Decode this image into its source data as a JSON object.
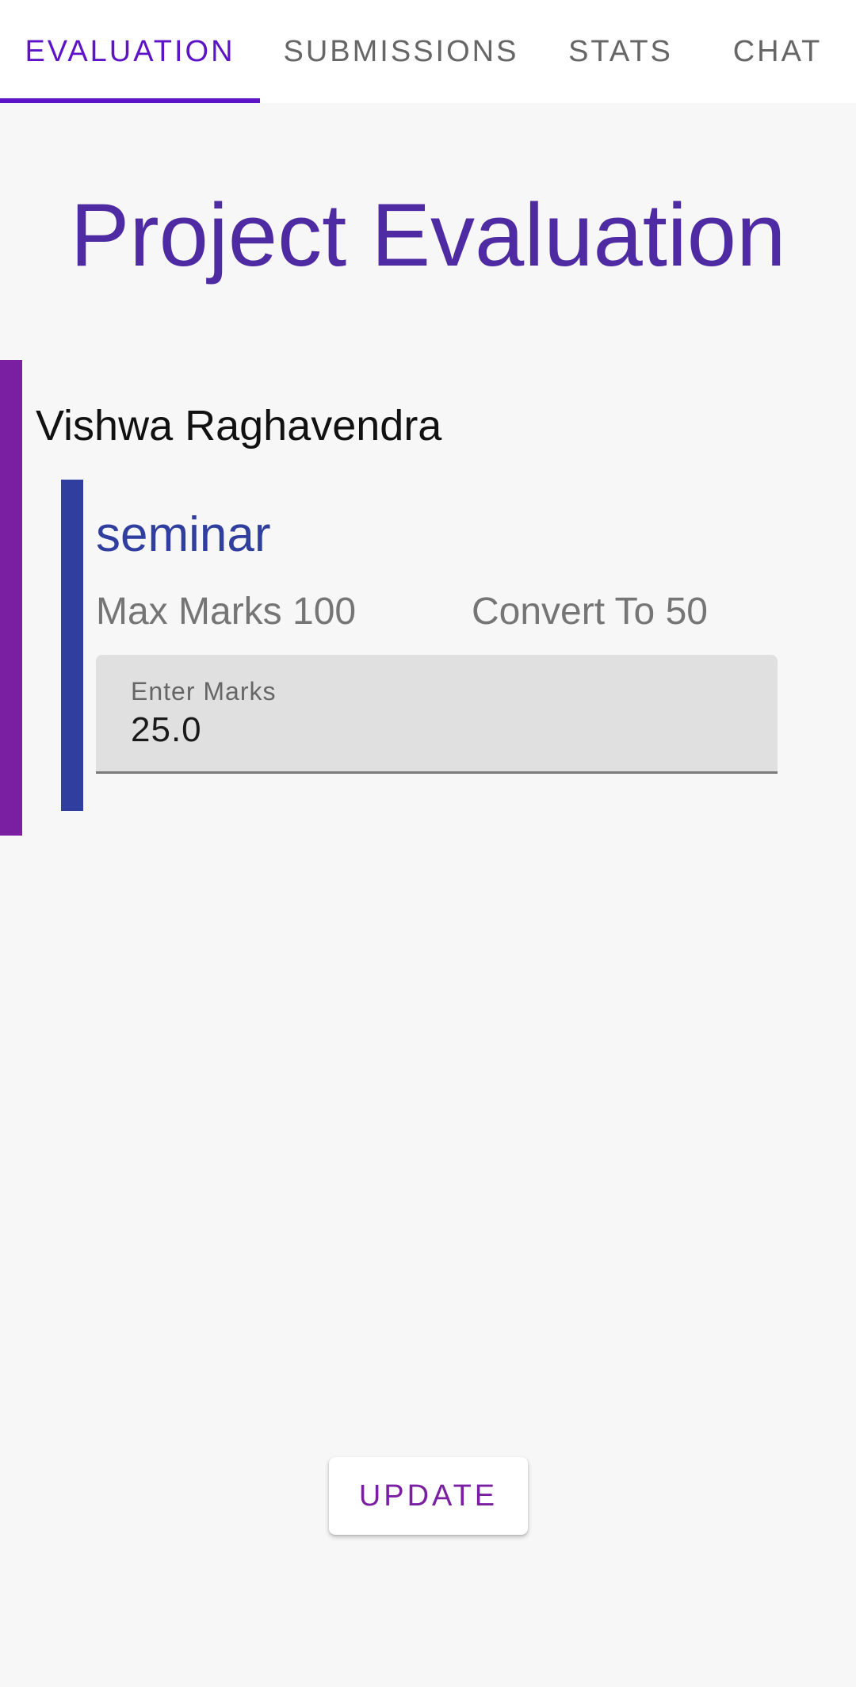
{
  "tabs": [
    {
      "label": "EVALUATION",
      "active": true
    },
    {
      "label": "SUBMISSIONS",
      "active": false
    },
    {
      "label": "STATS",
      "active": false
    },
    {
      "label": "CHAT",
      "active": false
    }
  ],
  "page": {
    "title": "Project Evaluation"
  },
  "student": {
    "name": "Vishwa Raghavendra"
  },
  "criteria": {
    "name": "seminar",
    "max_marks_text": "Max Marks 100",
    "convert_to_text": "Convert To 50",
    "marks_field": {
      "label": "Enter Marks",
      "value": "25.0"
    }
  },
  "actions": {
    "update_label": "UPDATE"
  },
  "colors": {
    "active_tab": "#5d14c7",
    "title": "#4f2ba3",
    "student_bar": "#7b1fa2",
    "criteria_bar": "#303f9f",
    "update_text": "#7b1fa2"
  }
}
